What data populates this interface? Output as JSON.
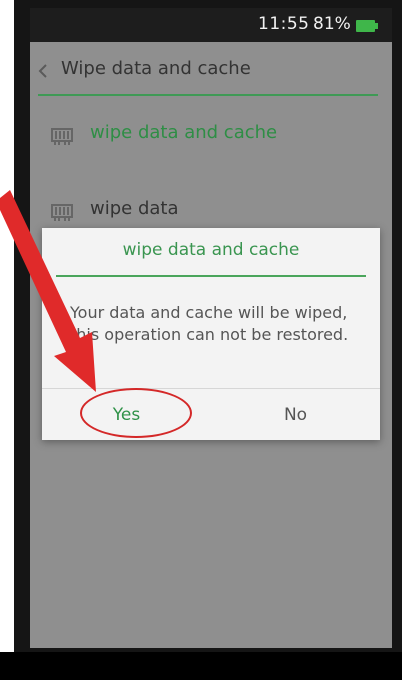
{
  "status_bar": {
    "time": "11:55",
    "battery_percent": "81%",
    "battery_icon": "battery-icon"
  },
  "app_bar": {
    "back_icon": "chevron-left-icon",
    "title": "Wipe data and cache"
  },
  "list": {
    "items": [
      {
        "label": "wipe data and cache",
        "icon": "storage-icon",
        "color": "#2e8e45"
      },
      {
        "label": "wipe data",
        "icon": "storage-icon",
        "color": "#333333"
      }
    ]
  },
  "dialog": {
    "title": "wipe data and cache",
    "message": "Your data and cache will be wiped, this operation can not be restored.",
    "yes_label": "Yes",
    "no_label": "No"
  },
  "colors": {
    "accent": "#3f9a55",
    "annotation": "#d42828"
  }
}
